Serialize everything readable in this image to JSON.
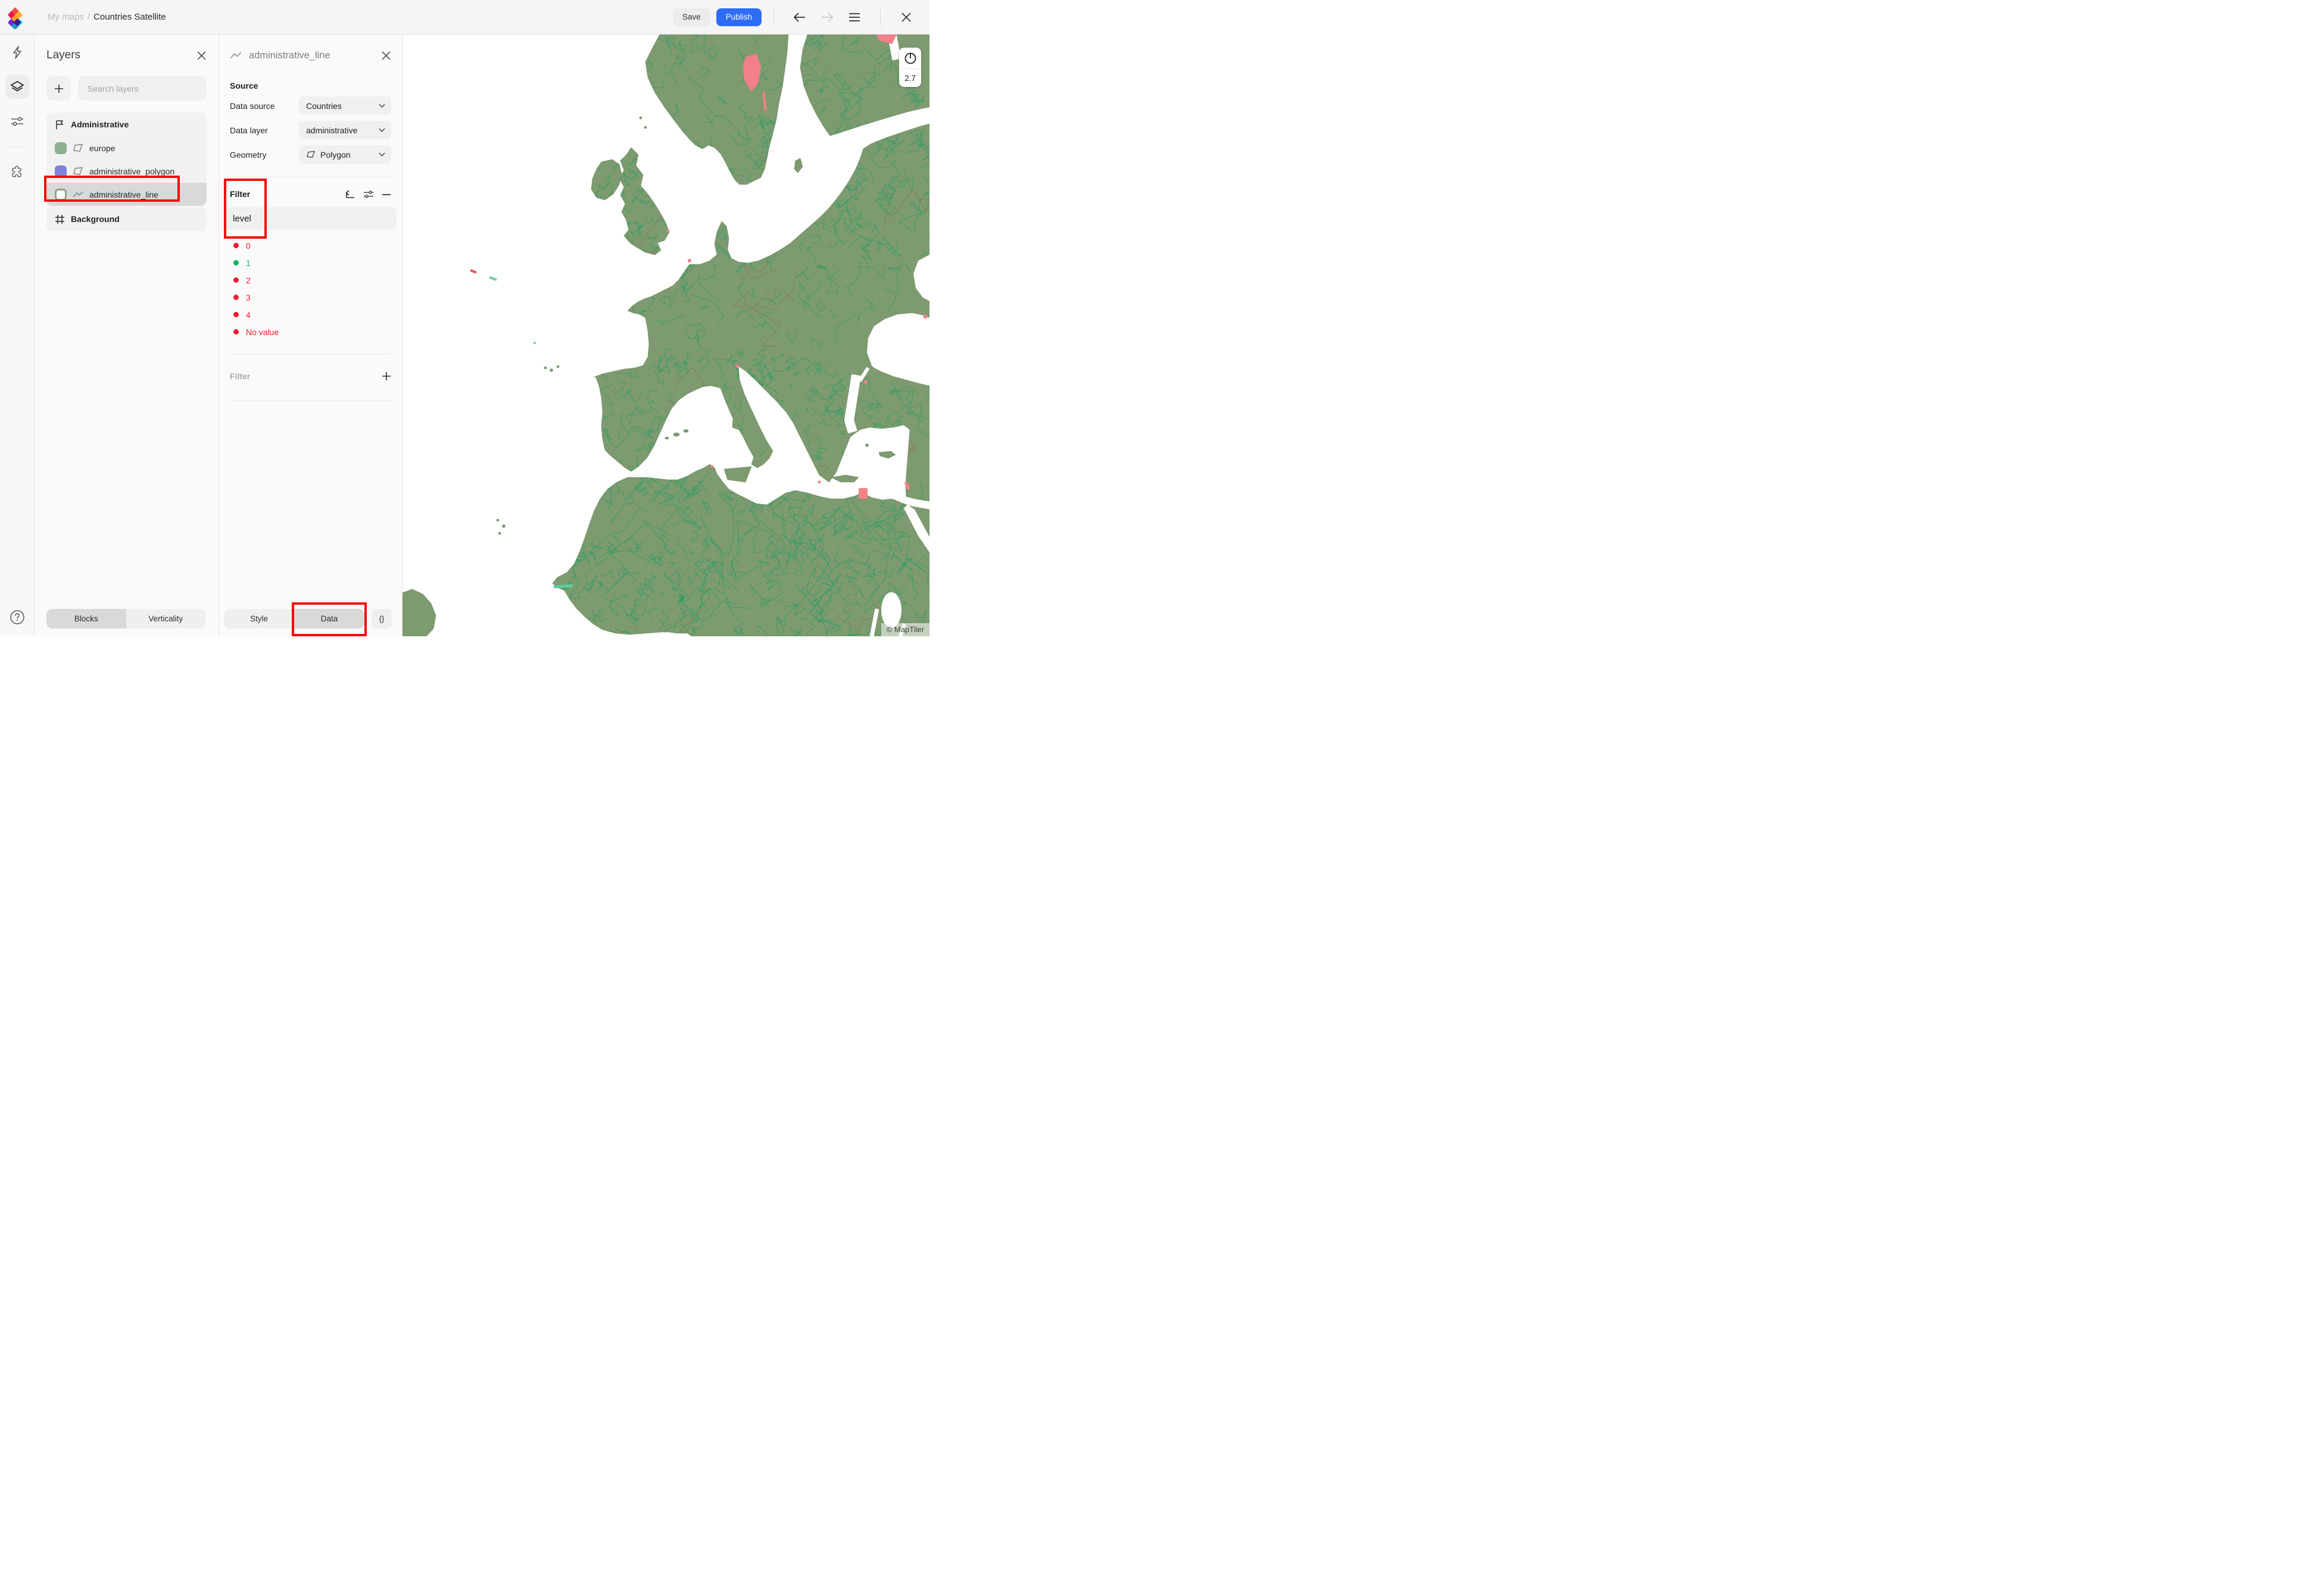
{
  "topbar": {
    "breadcrumb_root": "My maps",
    "breadcrumb_separator": "/",
    "title": "Countries Satellite",
    "save_label": "Save",
    "publish_label": "Publish"
  },
  "layers_panel": {
    "title": "Layers",
    "search_placeholder": "Search layers",
    "group_label": "Administrative",
    "layers": [
      {
        "name": "europe",
        "swatch": "#8cb08f",
        "type": "polygon"
      },
      {
        "name": "administrative_polygon",
        "swatch": "#7d83d9",
        "type": "polygon"
      },
      {
        "name": "administrative_line",
        "swatch_border": "#93a284",
        "type": "line",
        "selected": true
      }
    ],
    "background_label": "Background",
    "blocks_tab": "Blocks",
    "verticality_tab": "Verticality"
  },
  "inspector": {
    "layer_title": "administrative_line",
    "source_heading": "Source",
    "data_source_label": "Data source",
    "data_source_value": "Countries",
    "data_layer_label": "Data layer",
    "data_layer_value": "administrative",
    "geometry_label": "Geometry",
    "geometry_value": "Polygon",
    "filter_heading": "Filter",
    "filter_field_value": "level",
    "filter_values": [
      {
        "label": "0",
        "color": "#ed1b2e"
      },
      {
        "label": "1",
        "color": "#10b45f"
      },
      {
        "label": "2",
        "color": "#ed1b2e"
      },
      {
        "label": "3",
        "color": "#ed1b2e"
      },
      {
        "label": "4",
        "color": "#ed1b2e"
      },
      {
        "label": "No value",
        "color": "#ed1b2e"
      }
    ],
    "filter_add_label": "Filter",
    "style_tab": "Style",
    "data_tab": "Data",
    "json_button": "{}"
  },
  "map": {
    "zoom_level": "2.7",
    "attribution": "© MapTiler",
    "colors": {
      "land": "#7e9a70",
      "boundary_green": "#1ea05f",
      "boundary_brown": "#8c6f52",
      "highlight_pink": "#f28089",
      "highlight_teal": "#5ecfa0"
    }
  }
}
